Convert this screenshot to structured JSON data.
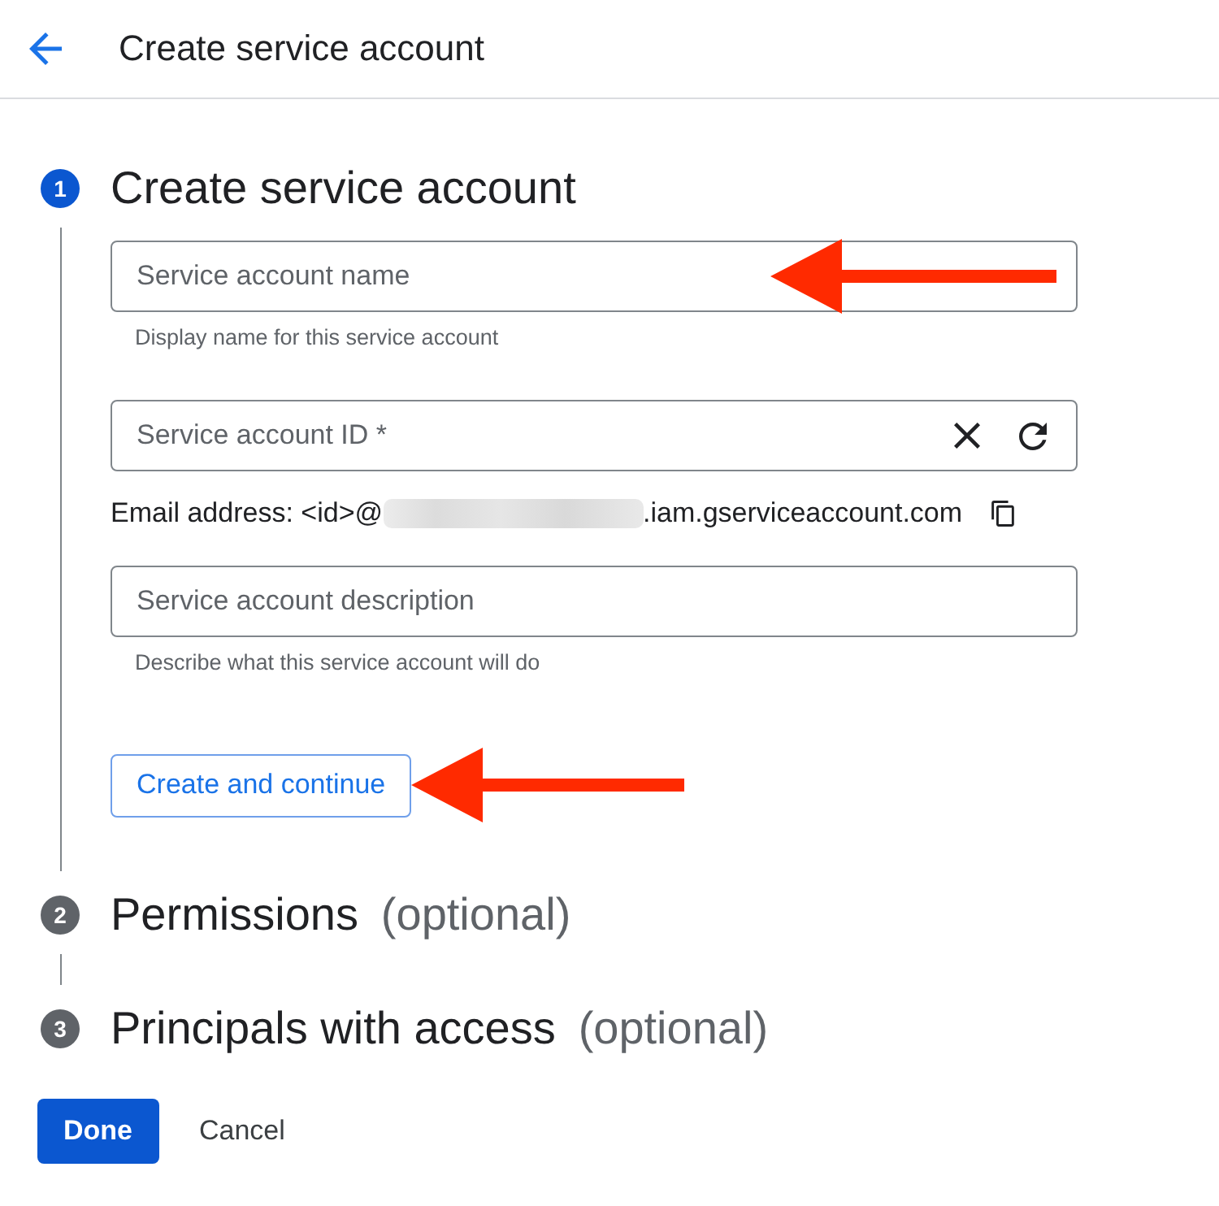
{
  "header": {
    "title": "Create service account"
  },
  "steps": [
    {
      "number": "1",
      "title": "Create service account",
      "selected": true,
      "items": [
        {
          "kind": "field",
          "placeholder": "Service account name",
          "hint": "Display name for this service account",
          "arrow_callout": true
        },
        {
          "kind": "field_with_actions",
          "placeholder": "Service account ID *",
          "arrow_callout": false
        },
        {
          "kind": "email",
          "prefix": "Email address: <id>@",
          "redacted": true,
          "suffix": ".iam.gserviceaccount.com",
          "arrow_callout": false
        },
        {
          "kind": "field",
          "placeholder": "Service account description",
          "hint": "Describe what this service account will do",
          "arrow_callout": false
        },
        {
          "kind": "button",
          "label": "Create and continue",
          "arrow_callout": true
        }
      ]
    },
    {
      "number": "2",
      "title": "Permissions",
      "suffix": "(optional)",
      "selected": false
    },
    {
      "number": "3",
      "title": "Principals with access",
      "suffix": "(optional)",
      "selected": false
    }
  ],
  "footer": {
    "buttons": [
      {
        "kind": "primary",
        "label": "Done"
      },
      {
        "kind": "text",
        "label": "Cancel"
      }
    ]
  }
}
